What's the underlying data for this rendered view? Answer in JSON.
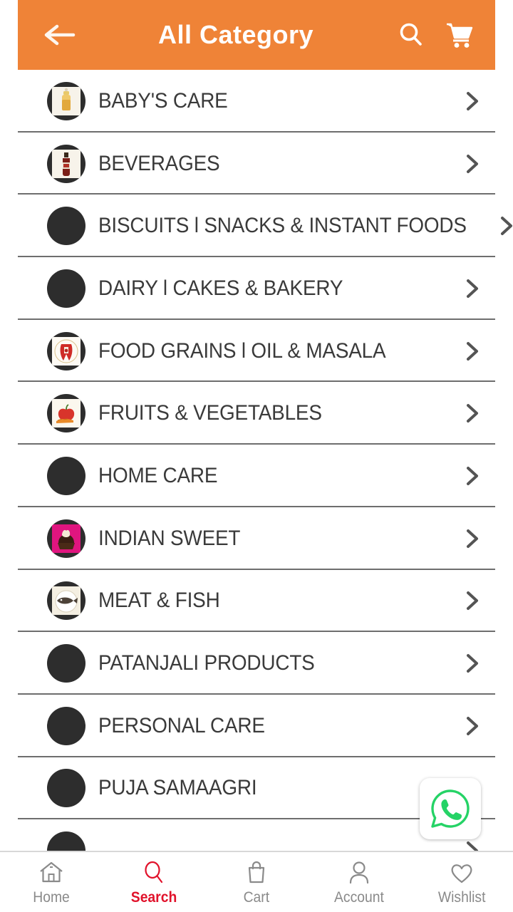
{
  "header": {
    "title": "All Category",
    "back_icon": "arrow-left-icon",
    "search_icon": "search-icon",
    "cart_icon": "cart-icon",
    "background_color": "#ef8337",
    "title_color": "#ffffff"
  },
  "categories": [
    {
      "label": "BABY'S CARE",
      "icon": "category-thumbnail",
      "has_image": true,
      "image_kind": "baby-bottle"
    },
    {
      "label": "BEVERAGES",
      "icon": "category-thumbnail",
      "has_image": true,
      "image_kind": "beverage-bottle"
    },
    {
      "label": "BISCUITS l SNACKS & INSTANT FOODS",
      "icon": "category-thumbnail",
      "has_image": false,
      "image_kind": ""
    },
    {
      "label": "DAIRY l CAKES & BAKERY",
      "icon": "category-thumbnail",
      "has_image": false,
      "image_kind": ""
    },
    {
      "label": "FOOD GRAINS l OIL & MASALA",
      "icon": "category-thumbnail",
      "has_image": true,
      "image_kind": "grains-spices"
    },
    {
      "label": "FRUITS & VEGETABLES",
      "icon": "category-thumbnail",
      "has_image": true,
      "image_kind": "fruits-veggies"
    },
    {
      "label": "HOME CARE",
      "icon": "category-thumbnail",
      "has_image": false,
      "image_kind": ""
    },
    {
      "label": "INDIAN SWEET",
      "icon": "category-thumbnail",
      "has_image": true,
      "image_kind": "sweet-cupcake"
    },
    {
      "label": "MEAT & FISH",
      "icon": "category-thumbnail",
      "has_image": true,
      "image_kind": "fish-plate"
    },
    {
      "label": "PATANJALI PRODUCTS",
      "icon": "category-thumbnail",
      "has_image": false,
      "image_kind": ""
    },
    {
      "label": "PERSONAL CARE",
      "icon": "category-thumbnail",
      "has_image": false,
      "image_kind": ""
    },
    {
      "label": "PUJA SAMAAGRI",
      "icon": "category-thumbnail",
      "has_image": false,
      "image_kind": ""
    },
    {
      "label": "",
      "icon": "category-thumbnail",
      "has_image": false,
      "image_kind": ""
    }
  ],
  "row_chevron_icon": "chevron-right-icon",
  "floating_button": {
    "icon": "whatsapp-icon",
    "color": "#25d366"
  },
  "bottom_nav": {
    "active_color": "#e1122b",
    "inactive_color": "#8a8a8a",
    "items": [
      {
        "label": "Home",
        "icon": "home-icon",
        "active": false
      },
      {
        "label": "Search",
        "icon": "search-icon",
        "active": true
      },
      {
        "label": "Cart",
        "icon": "bag-icon",
        "active": false
      },
      {
        "label": "Account",
        "icon": "person-icon",
        "active": false
      },
      {
        "label": "Wishlist",
        "icon": "heart-icon",
        "active": false
      }
    ]
  }
}
